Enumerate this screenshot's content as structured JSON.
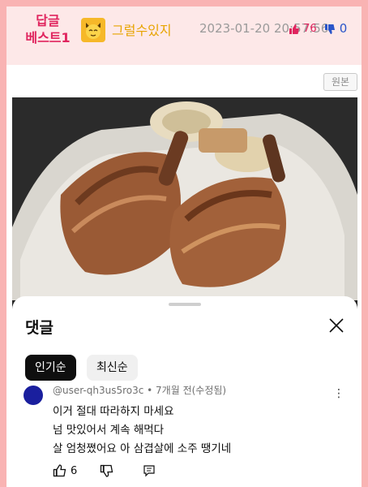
{
  "post": {
    "badge_line1": "답글",
    "badge_line2": "베스트1",
    "author": "그럴수있지",
    "date": "2023-01-20 20:57:56",
    "upvotes": "76",
    "downvotes": "0",
    "original_button": "원본"
  },
  "comments_panel": {
    "title": "댓글",
    "tabs": [
      {
        "label": "인기순",
        "active": true
      },
      {
        "label": "최신순",
        "active": false
      }
    ],
    "comment": {
      "meta": "@user-qh3us5ro3c • 7개월 전(수정됨)",
      "lines": [
        "이거 절대 따라하지 마세요",
        "넘 맛있어서 계속 해먹다",
        "살 엄청쪘어요 아 삼겹살에 소주 땡기네"
      ],
      "likes": "6"
    }
  },
  "colors": {
    "page_border": "#f9b3b3",
    "header_bg": "#fde8e8",
    "badge": "#e0245e",
    "author": "#e7a400",
    "downvote": "#2a55c9",
    "comment_avatar": "#1a1f9e"
  }
}
